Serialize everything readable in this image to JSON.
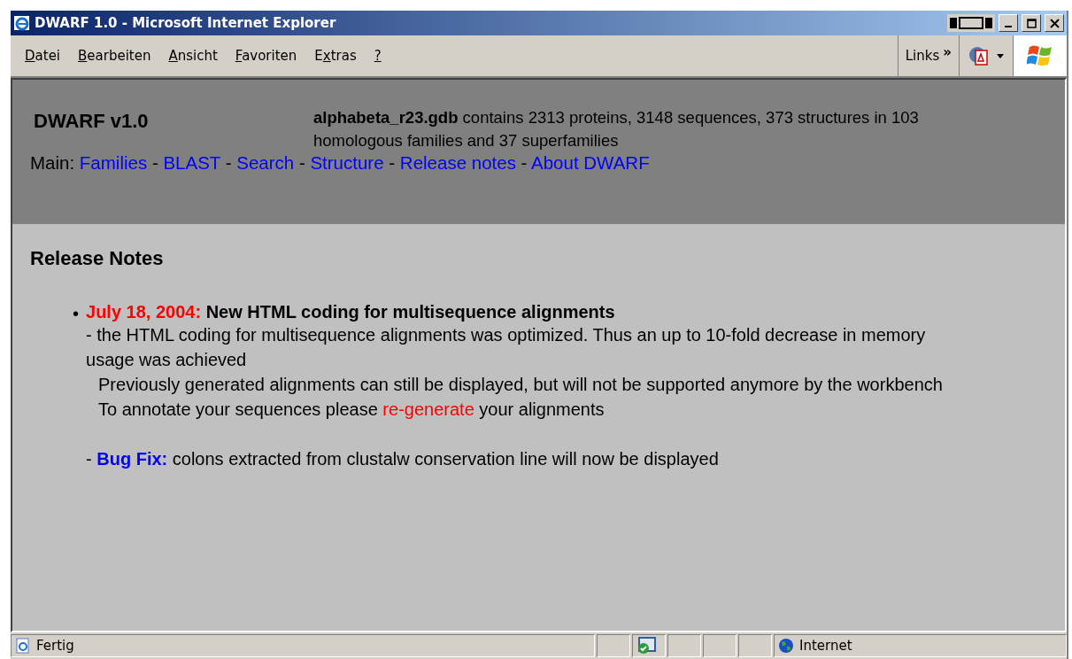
{
  "window": {
    "title": "DWARF 1.0 - Microsoft Internet Explorer"
  },
  "menu": [
    {
      "key": "D",
      "post": "atei"
    },
    {
      "key": "B",
      "post": "earbeiten"
    },
    {
      "key": "A",
      "post": "nsicht"
    },
    {
      "key": "F",
      "post": "avoriten"
    },
    {
      "pre": "E",
      "key": "x",
      "post": "tras"
    },
    {
      "key": "?"
    }
  ],
  "links_bar": {
    "label": "Links",
    "chevron": "»"
  },
  "header": {
    "title": "DWARF v1.0",
    "db_info": "**alphabeta_r23.gdb** contains 2313 proteins, 3148 sequences, 373 structures in 103 homologous families and 37 superfamilies",
    "nav_label": "Main:",
    "nav": [
      {
        "kind": "link",
        "text": "Families"
      },
      {
        "kind": "sep",
        "text": "-"
      },
      {
        "kind": "link",
        "text": "BLAST"
      },
      {
        "kind": "sep",
        "text": "-"
      },
      {
        "kind": "link",
        "text": "Search"
      },
      {
        "kind": "sep",
        "text": "-"
      },
      {
        "kind": "link",
        "text": "Structure"
      },
      {
        "kind": "sep",
        "text": "-"
      },
      {
        "kind": "link",
        "text": "Release notes"
      },
      {
        "kind": "sep",
        "text": "-"
      },
      {
        "kind": "link",
        "text": "About DWARF"
      }
    ]
  },
  "release_notes": {
    "heading": "Release Notes",
    "entries": [
      {
        "bullet": "•",
        "date": "July 18, 2004:",
        "title": "New HTML coding for multisequence alignments",
        "lines": [
          {
            "indented": false,
            "parts": [
              {
                "kind": "text",
                "text": "- the HTML coding for multisequence alignments was optimized. Thus an up to 10-fold decrease in memory usage was achieved"
              }
            ]
          },
          {
            "indented": true,
            "parts": [
              {
                "kind": "text",
                "text": "Previously generated alignments can still be displayed, but will not be supported anymore by the workbench"
              }
            ]
          },
          {
            "indented": true,
            "parts": [
              {
                "kind": "text",
                "text": "To annotate your sequences please "
              },
              {
                "kind": "link",
                "text": "re-generate"
              },
              {
                "kind": "text",
                "text": " your alignments"
              }
            ]
          },
          {
            "indented": false,
            "gap": true,
            "parts": [
              {
                "kind": "text",
                "text": "- "
              },
              {
                "kind": "label",
                "text": "Bug Fix:"
              },
              {
                "kind": "text",
                "text": " colons extracted from clustalw conservation line will now be displayed"
              }
            ]
          }
        ]
      }
    ]
  },
  "status_bar": {
    "text": "Fertig",
    "zone": "Internet"
  }
}
